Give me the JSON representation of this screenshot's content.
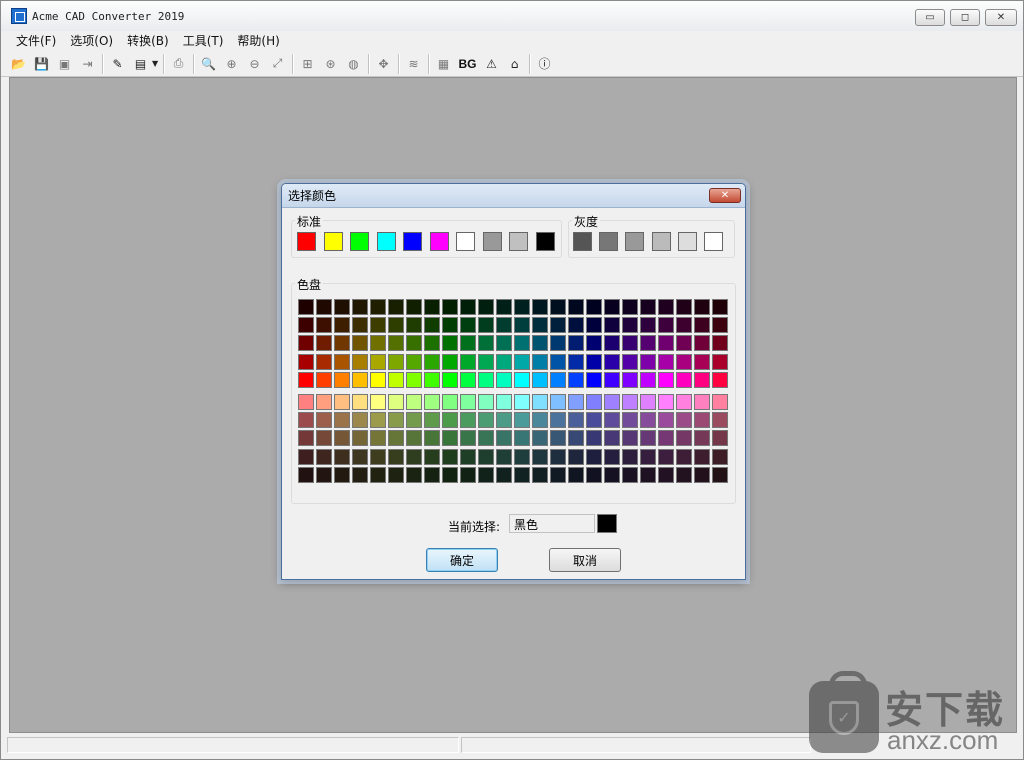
{
  "window": {
    "title": "Acme CAD Converter 2019",
    "controls": {
      "minimize": "▭",
      "maximize": "◻",
      "close": "✕"
    }
  },
  "menu": {
    "items": [
      {
        "label": "文件(F)"
      },
      {
        "label": "选项(O)"
      },
      {
        "label": "转换(B)"
      },
      {
        "label": "工具(T)"
      },
      {
        "label": "帮助(H)"
      }
    ]
  },
  "toolbar": {
    "buttons": [
      {
        "name": "open-icon",
        "glyph": "📂",
        "enabled": true
      },
      {
        "name": "save-icon",
        "glyph": "💾",
        "enabled": false
      },
      {
        "name": "save-all-icon",
        "glyph": "▣",
        "enabled": false
      },
      {
        "name": "export-icon",
        "glyph": "⇥",
        "enabled": false
      },
      {
        "sep": true
      },
      {
        "name": "convert-pdf-icon",
        "glyph": "✎",
        "enabled": true
      },
      {
        "name": "batch-convert-icon",
        "glyph": "▤",
        "enabled": true,
        "dropdown": true
      },
      {
        "sep": true
      },
      {
        "name": "print-icon",
        "glyph": "⎙",
        "enabled": false
      },
      {
        "sep": true
      },
      {
        "name": "zoom-icon",
        "glyph": "🔍",
        "enabled": false
      },
      {
        "name": "zoom-in-icon",
        "glyph": "⊕",
        "enabled": false
      },
      {
        "name": "zoom-out-icon",
        "glyph": "⊖",
        "enabled": false
      },
      {
        "name": "zoom-extents-icon",
        "glyph": "⤢",
        "enabled": false
      },
      {
        "sep": true
      },
      {
        "name": "zoom-window-icon",
        "glyph": "⊞",
        "enabled": false
      },
      {
        "name": "zoom-realtime-icon",
        "glyph": "⊛",
        "enabled": false
      },
      {
        "name": "orbit-icon",
        "glyph": "◍",
        "enabled": false
      },
      {
        "sep": true
      },
      {
        "name": "pan-icon",
        "glyph": "✥",
        "enabled": false
      },
      {
        "sep": true
      },
      {
        "name": "layers-icon",
        "glyph": "≋",
        "enabled": false
      },
      {
        "sep": true
      },
      {
        "name": "black-white-icon",
        "glyph": "▦",
        "enabled": false
      },
      {
        "name": "background-color-button",
        "glyph": "BG",
        "enabled": true,
        "text": true
      },
      {
        "name": "properties-icon",
        "glyph": "⚠",
        "enabled": true
      },
      {
        "name": "home-icon",
        "glyph": "⌂",
        "enabled": true
      },
      {
        "sep": true
      },
      {
        "name": "about-icon",
        "glyph": "ⓘ",
        "enabled": true
      }
    ]
  },
  "dialog": {
    "title": "选择颜色",
    "close_glyph": "✕",
    "standard": {
      "label": "标准",
      "colors": [
        "#ff0000",
        "#ffff00",
        "#00ff00",
        "#00ffff",
        "#0000ff",
        "#ff00ff",
        "#ffffff",
        "#999999",
        "#c0c0c0",
        "#000000"
      ]
    },
    "gray": {
      "label": "灰度",
      "colors": [
        "#555555",
        "#777777",
        "#999999",
        "#bbbbbb",
        "#dddddd",
        "#ffffff"
      ]
    },
    "palette": {
      "label": "色盘",
      "hue_columns": 24,
      "rows_top": [
        {
          "lightness": 0.06,
          "saturation": 1.0
        },
        {
          "lightness": 0.12,
          "saturation": 1.0
        },
        {
          "lightness": 0.22,
          "saturation": 1.0
        },
        {
          "lightness": 0.33,
          "saturation": 1.0
        },
        {
          "lightness": 0.5,
          "saturation": 1.0
        }
      ],
      "rows_bottom": [
        {
          "lightness": 0.75,
          "saturation": 1.0
        },
        {
          "lightness": 0.45,
          "saturation": 0.35
        },
        {
          "lightness": 0.34,
          "saturation": 0.35
        },
        {
          "lightness": 0.18,
          "saturation": 0.35
        },
        {
          "lightness": 0.1,
          "saturation": 0.35
        }
      ]
    },
    "current": {
      "label": "当前选择:",
      "value": "黑色",
      "color": "#000000"
    },
    "ok_label": "确定",
    "cancel_label": "取消"
  },
  "watermark": {
    "text_cn": "安下载",
    "text_en": "anxz.com"
  }
}
